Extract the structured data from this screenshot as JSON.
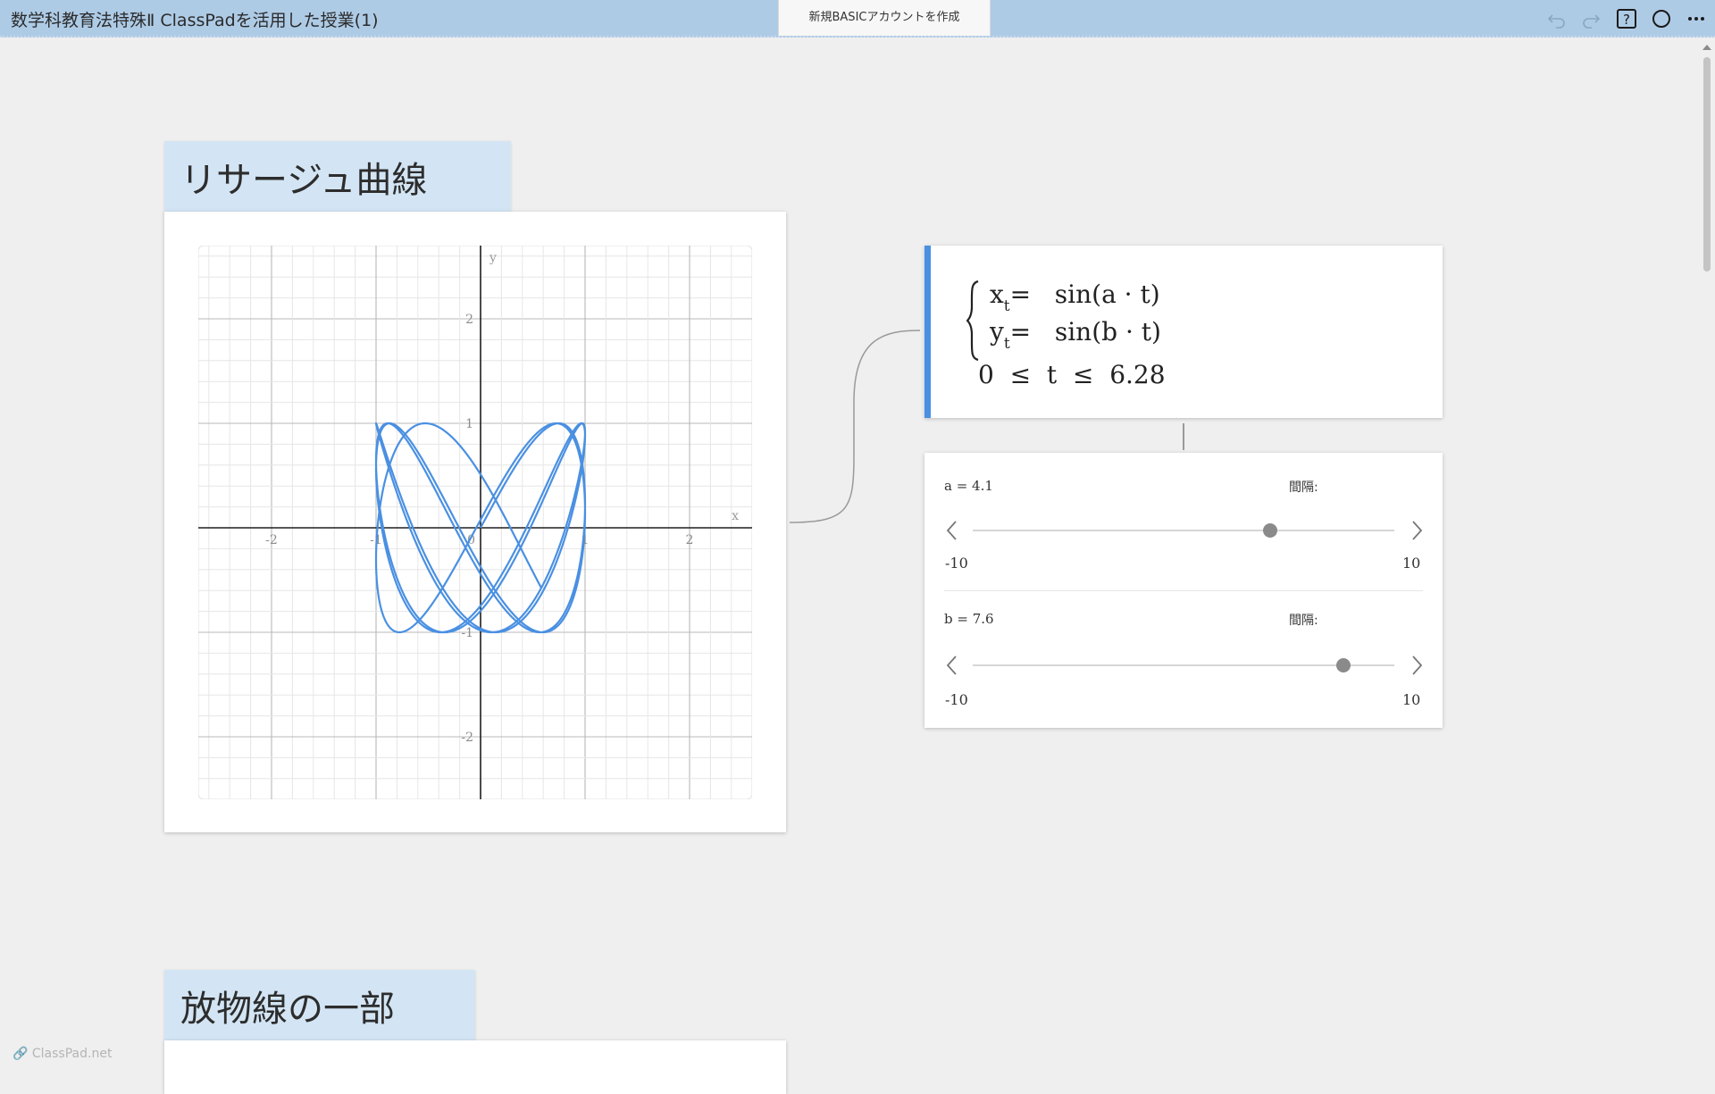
{
  "header": {
    "title": "数学科教育法特殊Ⅱ ClassPadを活用した授業(1)",
    "center_tab": "新規BASICアカウントを作成",
    "icons": [
      "undo-icon",
      "redo-icon",
      "help-icon",
      "circle-icon",
      "more-icon"
    ]
  },
  "sections": {
    "lissajous_title": "リサージュ曲線",
    "parabola_title": "放物線の一部"
  },
  "graph": {
    "x_axis_label": "x",
    "y_axis_label": "y",
    "x_ticks": [
      "-2",
      "-1",
      "0",
      "1",
      "2"
    ],
    "y_ticks": [
      "2",
      "1",
      "-1",
      "-2"
    ],
    "curve_color": "#4a90e2"
  },
  "equation": {
    "x_lhs": "x",
    "x_sub": "t",
    "x_rhs": "=   sin(a · t)",
    "y_lhs": "y",
    "y_sub": "t",
    "y_rhs": "=   sin(b · t)",
    "range": "0  ≤  t  ≤  6.28"
  },
  "sliders": [
    {
      "label": "a = 4.1",
      "value": 4.1,
      "step_label": "間隔:",
      "min": "-10",
      "max": "10"
    },
    {
      "label": "b = 7.6",
      "value": 7.6,
      "step_label": "間隔:",
      "min": "-10",
      "max": "10"
    }
  ],
  "watermark": "ClassPad.net"
}
